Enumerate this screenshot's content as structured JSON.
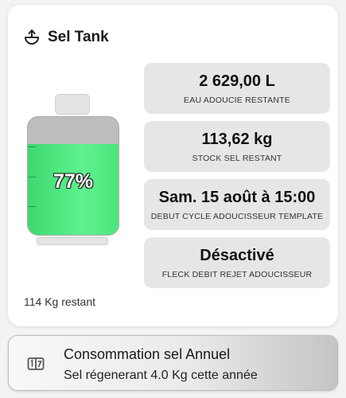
{
  "card": {
    "title": "Sel Tank",
    "icon": "scale-icon",
    "tank": {
      "fill_percent": 77,
      "percent_label": "77%",
      "fill_color": "#4ee683"
    },
    "remaining_text": "114 Kg restant",
    "stats": [
      {
        "value": "2 629,00 L",
        "label": "EAU ADOUCIE RESTANTE"
      },
      {
        "value": "113,62 kg",
        "label": "STOCK SEL RESTANT"
      },
      {
        "value": "Sam. 15 août à 15:00",
        "label": "DEBUT CYCLE ADOUCISSEUR TEMPLATE"
      },
      {
        "value": "Désactivé",
        "label": "FLECK DEBIT REJET ADOUCISSEUR"
      }
    ]
  },
  "bottom": {
    "icon": "counter-icon",
    "title": "Consommation sel Annuel",
    "subtitle": "Sel régenerant 4.0 Kg cette année"
  }
}
